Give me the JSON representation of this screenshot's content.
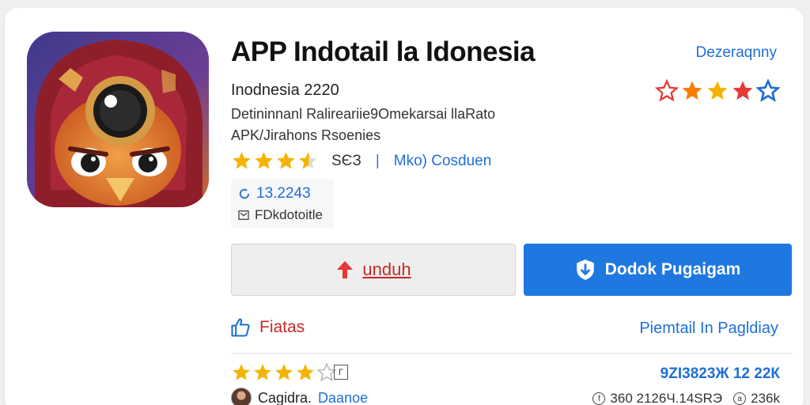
{
  "app": {
    "title": "APP Indotail la Idonesia",
    "subtitle": "Inodnesia 2220",
    "description_line1": "Detininnanl Ralireariie9Omekarsai llaRato",
    "description_line2": "APK/Jirahons Rsoenies",
    "rating_count": "SЄЗ",
    "separator": "|",
    "developer_link": "Mko) Cosduen"
  },
  "header": {
    "top_link": "Dezeraqnny"
  },
  "info": {
    "downloads": "13.2243",
    "category": "FDkdotoitle"
  },
  "actions": {
    "unduh_label": "unduh",
    "download_label": "Dodok Pugaigam",
    "share_label": "Fiatas",
    "more_link": "Piemtail In Pagldiay"
  },
  "review": {
    "flag_char": "Г",
    "stats": "9ZI3823Ж 12 22К",
    "user_name": "Cagidra.",
    "user_tag": "Daanoe",
    "bottom_icon1": "f",
    "bottom_text": "360 2126Ч.14SRЭ",
    "bottom_icon2": "a",
    "bottom_text2": "236k"
  },
  "ratings": {
    "main_stars": 3.5,
    "top_stars_colors": [
      "outline-red",
      "orange",
      "gold",
      "red",
      "outline-blue"
    ],
    "review_stars": 4
  },
  "colors": {
    "accent_blue": "#1f78e0",
    "link_blue": "#1f6fd6",
    "red": "#c62828",
    "star_gold": "#f5b301"
  },
  "icons": {
    "upload": "arrow-up-icon",
    "download": "shield-download-icon",
    "share": "thumbs-up-icon",
    "downloads": "circle-refresh-icon",
    "category": "flag-box-icon"
  }
}
